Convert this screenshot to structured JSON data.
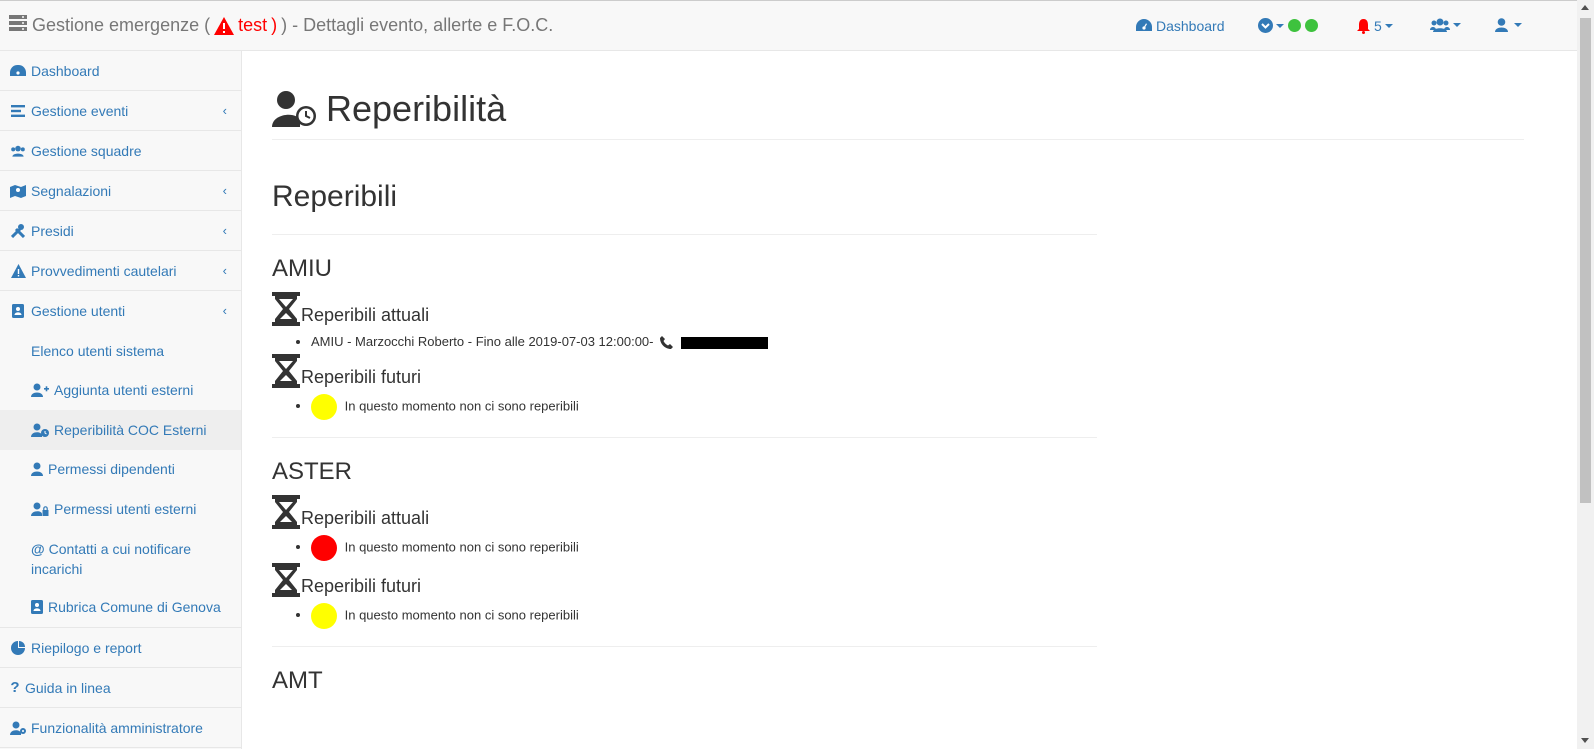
{
  "header": {
    "title_prefix": "Gestione emergenze (",
    "event_name": "test",
    "title_suffix": ") - Dettagli evento, allerte e F.O.C.",
    "dashboard_label": "Dashboard",
    "notifications_count": "5"
  },
  "sidebar": {
    "items": [
      {
        "label": "Dashboard"
      },
      {
        "label": "Gestione eventi"
      },
      {
        "label": "Gestione squadre"
      },
      {
        "label": "Segnalazioni"
      },
      {
        "label": "Presidi"
      },
      {
        "label": "Provvedimenti cautelari"
      },
      {
        "label": "Gestione utenti"
      }
    ],
    "subitems": [
      {
        "label": "Elenco utenti sistema"
      },
      {
        "label": "Aggiunta utenti esterni"
      },
      {
        "label": "Reperibilità COC Esterni"
      },
      {
        "label": "Permessi dipendenti"
      },
      {
        "label": "Permessi utenti esterni"
      },
      {
        "label": "Contatti a cui notificare incarichi"
      },
      {
        "label": "Rubrica Comune di Genova"
      }
    ],
    "bottom_items": [
      {
        "label": "Riepilogo e report"
      },
      {
        "label": "Guida in linea"
      },
      {
        "label": "Funzionalità amministratore"
      }
    ]
  },
  "main": {
    "page_title": "Reperibilità",
    "section_title": "Reperibili",
    "current_label": "Reperibili attuali",
    "future_label": "Reperibili futuri",
    "none_message": "In questo momento non ci sono reperibili",
    "orgs": [
      {
        "name": "AMIU",
        "current_entry": "AMIU - Marzocchi Roberto - Fino alle 2019-07-03 12:00:00-"
      },
      {
        "name": "ASTER"
      },
      {
        "name": "AMT"
      }
    ]
  },
  "colors": {
    "link": "#337ab7",
    "alert_red": "#ff0000",
    "status_green": "#3ec23e",
    "dot_yellow": "#ffff00",
    "dot_red": "#ff0000"
  }
}
